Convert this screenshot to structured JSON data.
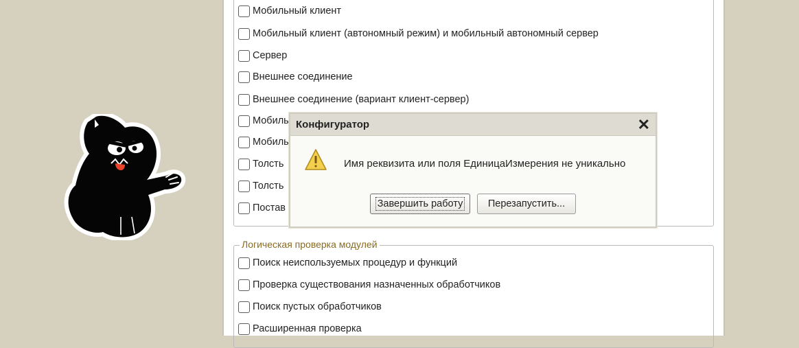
{
  "top_group": {
    "checkboxes": [
      {
        "label": "Мобильный клиент",
        "checked": false
      },
      {
        "label": "Мобильный клиент (автономный режим) и мобильный автономный сервер",
        "checked": false
      },
      {
        "label": "Сервер",
        "checked": false
      },
      {
        "label": "Внешнее соединение",
        "checked": false
      },
      {
        "label": "Внешнее соединение (вариант клиент-сервер)",
        "checked": false
      },
      {
        "label": "Мобиль",
        "checked": false
      },
      {
        "label": "Мобиль",
        "checked": false
      },
      {
        "label": "Толсть",
        "checked": false
      },
      {
        "label": "Толсть",
        "checked": false
      },
      {
        "label": "Постав",
        "checked": false
      }
    ]
  },
  "bottom_group": {
    "legend": "Логическая проверка модулей",
    "checkboxes": [
      {
        "label": "Поиск неиспользуемых процедур и функций",
        "checked": false
      },
      {
        "label": "Проверка существования назначенных обработчиков",
        "checked": false
      },
      {
        "label": "Поиск пустых обработчиков",
        "checked": false
      },
      {
        "label": "Расширенная проверка",
        "checked": false
      }
    ]
  },
  "dialog": {
    "title": "Конфигуратор",
    "close_icon": "close-icon",
    "message_icon": "warning-icon",
    "message": "Имя реквизита или поля ЕдиницаИзмерения не уникально",
    "buttons": {
      "finish": "Завершить работу",
      "restart": "Перезапустить..."
    }
  },
  "mascot": {
    "icon": "black-cat-mascot"
  },
  "colors": {
    "background": "#d6d1bf",
    "legend_text": "#8a6a1e",
    "warning_fill": "#f2cf4c"
  }
}
